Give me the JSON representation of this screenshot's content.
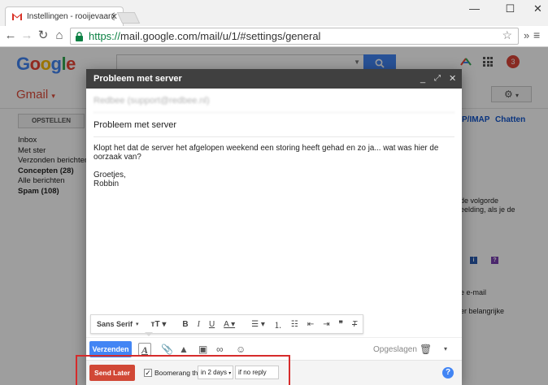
{
  "browser": {
    "tab_title": "Instellingen - rooijevaar@",
    "url_scheme": "https://",
    "url_rest": "mail.google.com/mail/u/1/#settings/general"
  },
  "gmail": {
    "logo": "Google",
    "product": "Gmail",
    "notification_count": "3",
    "compose_label": "OPSTELLEN",
    "nav": [
      {
        "label": "Inbox",
        "bold": false
      },
      {
        "label": "Met ster",
        "bold": false
      },
      {
        "label": "Verzonden berichten",
        "bold": false
      },
      {
        "label": "Concepten (28)",
        "bold": true
      },
      {
        "label": "Alle berichten",
        "bold": false
      },
      {
        "label": "Spam (108)",
        "bold": true
      }
    ],
    "tab_links": [
      "P/IMAP",
      "Chatten"
    ],
    "settings_fragments": [
      "de volgorde",
      "eelding, als je de",
      "e e-mail",
      "er belangrijke"
    ]
  },
  "compose": {
    "header_title": "Probleem met server",
    "to": "Redbee (support@redbee.nl)",
    "subject": "Probleem met server",
    "body_lines": [
      "Klopt het dat de server het afgelopen weekend een storing heeft gehad en zo ja... wat was hier de oorzaak van?",
      "Groetjes,",
      "Robbin"
    ],
    "format_font": "Sans Serif",
    "send_label": "Verzenden",
    "saved_label": "Opgeslagen"
  },
  "boomerang": {
    "send_later_label": "Send Later",
    "boomerang_checked": true,
    "boomerang_label": "Boomerang this",
    "duration": "in 2 days",
    "condition": "if no reply"
  },
  "colors": {
    "send": "#4285f4",
    "send_later": "#d14836",
    "highlight_box": "#d62b2b"
  }
}
